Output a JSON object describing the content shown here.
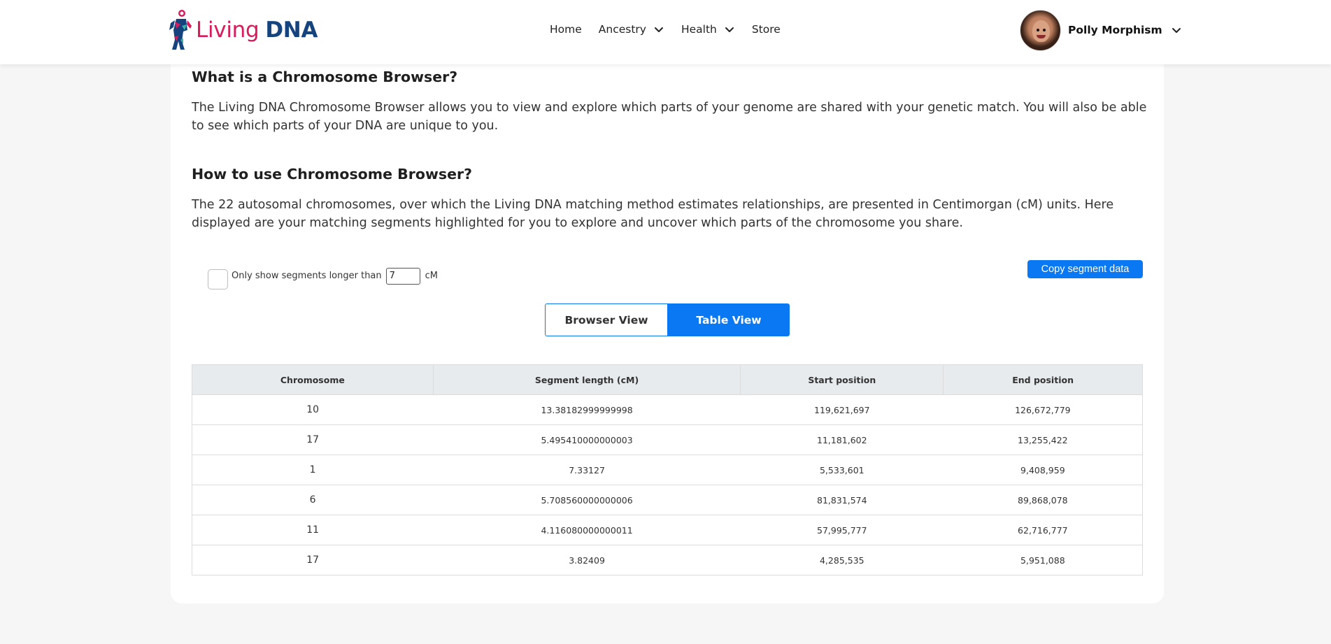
{
  "brand": {
    "living": "Living",
    "dna": "DNA",
    "colors": {
      "living": "#d81b5a",
      "dna": "#14437e",
      "accent": "#0a78f2"
    }
  },
  "nav": {
    "items": [
      {
        "label": "Home",
        "has_dropdown": false
      },
      {
        "label": "Ancestry",
        "has_dropdown": true
      },
      {
        "label": "Health",
        "has_dropdown": true
      },
      {
        "label": "Store",
        "has_dropdown": false
      }
    ],
    "dropdown_icon": "chevron-down-icon"
  },
  "user": {
    "name": "Polly Morphism",
    "avatar_icon": "avatar",
    "dropdown_icon": "chevron-down-icon"
  },
  "sections": [
    {
      "heading": "What is a Chromosome Browser?",
      "body": "The Living DNA Chromosome Browser allows you to view and explore which parts of your genome are shared with your genetic match. You will also be able to see which parts of your DNA are unique to you."
    },
    {
      "heading": "How to use Chromosome Browser?",
      "body": "The 22 autosomal chromosomes, over which the Living DNA matching method estimates relationships, are presented in Centimorgan (cM) units. Here displayed are your matching segments highlighted for you to explore and uncover which parts of the chromosome you share."
    }
  ],
  "filter": {
    "checked": false,
    "label": "Only show segments longer than",
    "value": "7",
    "unit": "cM"
  },
  "copy_button": "Copy segment data",
  "view_toggle": {
    "browser": "Browser View",
    "table": "Table View",
    "active": "table"
  },
  "table": {
    "columns": [
      "Chromosome",
      "Segment length (cM)",
      "Start position",
      "End position"
    ],
    "rows": [
      [
        "10",
        "13.38182999999998",
        "119,621,697",
        "126,672,779"
      ],
      [
        "17",
        "5.495410000000003",
        "11,181,602",
        "13,255,422"
      ],
      [
        "1",
        "7.33127",
        "5,533,601",
        "9,408,959"
      ],
      [
        "6",
        "5.708560000000006",
        "81,831,574",
        "89,868,078"
      ],
      [
        "11",
        "4.116080000000011",
        "57,995,777",
        "62,716,777"
      ],
      [
        "17",
        "3.82409",
        "4,285,535",
        "5,951,088"
      ]
    ]
  }
}
